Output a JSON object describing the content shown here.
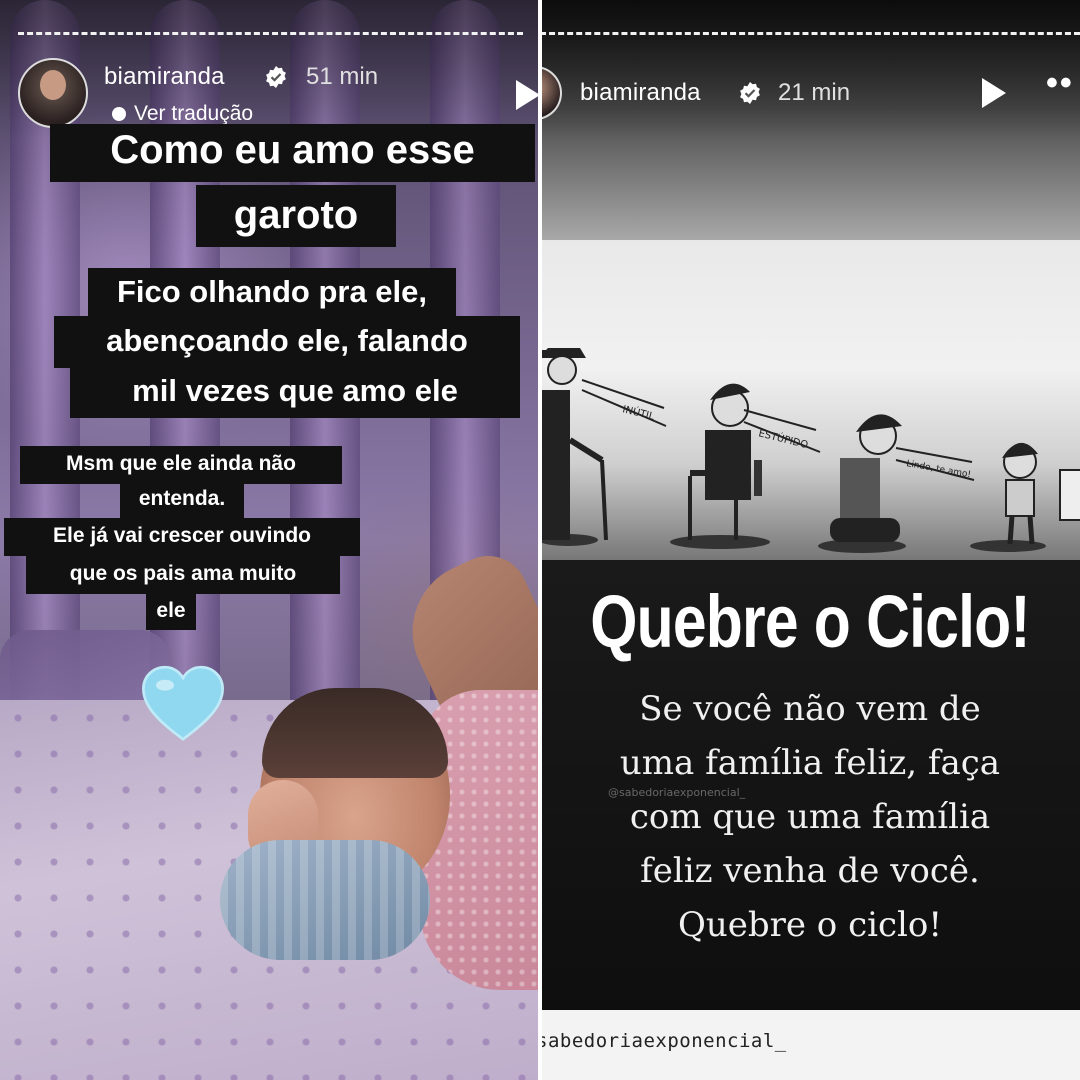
{
  "left_story": {
    "username": "biamiranda",
    "time": "51 min",
    "translate_label": "Ver tradução",
    "captions": {
      "line1": "Como eu amo esse",
      "line2": "garoto",
      "para1": [
        "Fico olhando pra ele,",
        "abençoando ele, falando",
        "mil vezes que amo ele"
      ],
      "para2": [
        "Msm que ele ainda não",
        "entenda.",
        "Ele já vai crescer ouvindo",
        "que os pais ama muito",
        "ele"
      ]
    },
    "sticker": "blue-heart",
    "progress": "dashed"
  },
  "right_story": {
    "username": "biamiranda",
    "time": "21 min",
    "cartoon_labels": [
      "INÚTIL",
      "ESTÚPIDO",
      "Lindo, te amo!"
    ],
    "headline": "Quebre o Ciclo!",
    "quote_lines": [
      "Se você não vem de",
      "uma família feliz, faça",
      "com que uma família",
      "feliz venha de você.",
      "Quebre o ciclo!"
    ],
    "watermark": "@sabedoriaexponencial_",
    "credit": "sabedoriaexponencial_"
  },
  "colors": {
    "caption_bg": "#111111",
    "caption_text": "#ffffff",
    "verified_badge": "#ffffff",
    "heart": "#8fd8f0",
    "quote_bg": "#0e0e0e"
  }
}
